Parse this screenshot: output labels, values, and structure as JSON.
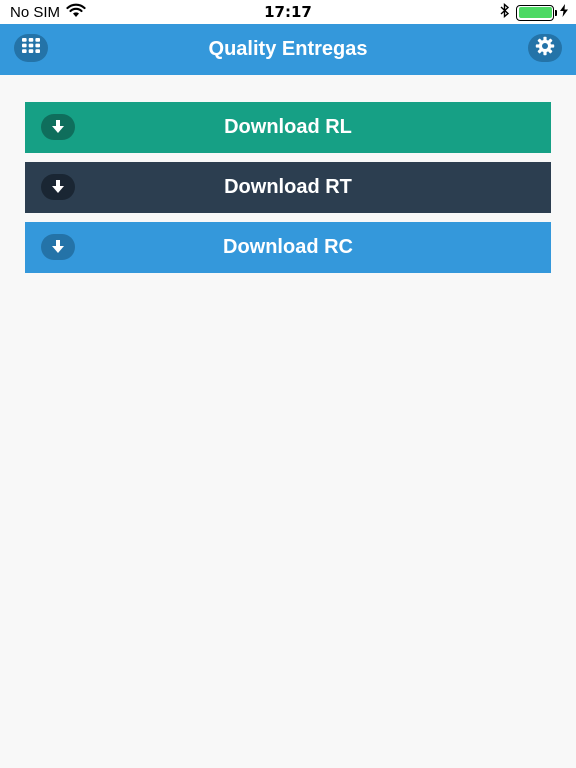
{
  "status": {
    "carrier": "No SIM",
    "time": "17:17"
  },
  "nav": {
    "title": "Quality Entregas",
    "left_icon": "grid-icon",
    "right_icon": "gear-icon"
  },
  "buttons": [
    {
      "label": "Download RL",
      "color": "#16a085",
      "icon_bg": "#0f6e5c"
    },
    {
      "label": "Download RT",
      "color": "#2c3e50",
      "icon_bg": "#1a2633"
    },
    {
      "label": "Download RC",
      "color": "#3498db",
      "icon_bg": "#2473a8"
    }
  ],
  "colors": {
    "nav": "#3498db",
    "nav_btn_bg": "#2473a8",
    "background": "#f8f8f8",
    "battery": "#4cd964"
  }
}
